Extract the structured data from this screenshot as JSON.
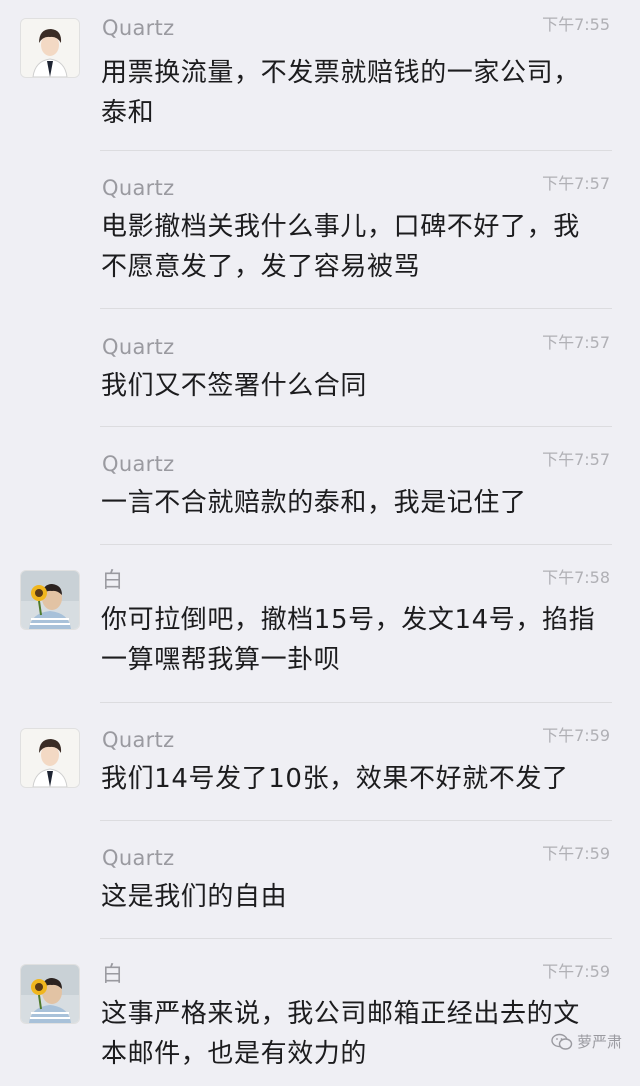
{
  "messages": [
    {
      "sender": "Quartz",
      "time": "下午7:55",
      "text": "用票换流量，不发票就赔钱的一家公司，\n泰和",
      "avatar": "boy-avatar"
    },
    {
      "sender": "Quartz",
      "time": "下午7:57",
      "text": "电影撤档关我什么事儿，口碑不好了，我\n不愿意发了，发了容易被骂",
      "avatar": ""
    },
    {
      "sender": "Quartz",
      "time": "下午7:57",
      "text": "我们又不签署什么合同",
      "avatar": ""
    },
    {
      "sender": "Quartz",
      "time": "下午7:57",
      "text": "一言不合就赔款的泰和，我是记住了",
      "avatar": ""
    },
    {
      "sender": "白",
      "time": "下午7:58",
      "text": "你可拉倒吧，撤档15号，发文14号，掐指\n一算嘿帮我算一卦呗",
      "avatar": "sunflower-avatar"
    },
    {
      "sender": "Quartz",
      "time": "下午7:59",
      "text": "我们14号发了10张，效果不好就不发了",
      "avatar": "boy-avatar"
    },
    {
      "sender": "Quartz",
      "time": "下午7:59",
      "text": "这是我们的自由",
      "avatar": ""
    },
    {
      "sender": "白",
      "time": "下午7:59",
      "text": "这事严格来说，我公司邮箱正经出去的文\n本邮件，也是有效力的",
      "avatar": "sunflower-avatar"
    }
  ],
  "watermark": {
    "label": "萝严肃",
    "icon": "wechat-icon"
  }
}
